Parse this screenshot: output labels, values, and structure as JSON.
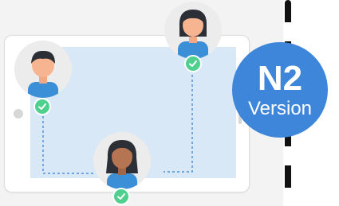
{
  "badge": {
    "title": "N2",
    "subtitle": "Version"
  },
  "participants": [
    {
      "icon": "male-avatar-icon"
    },
    {
      "icon": "female-avatar-icon"
    },
    {
      "icon": "female-dark-avatar-icon"
    }
  ],
  "colors": {
    "badge_blue": "#3d86d9",
    "check_green": "#4fd08e",
    "screen_blue": "#d8e8f7",
    "shirt_blue": "#3a8fd6"
  }
}
